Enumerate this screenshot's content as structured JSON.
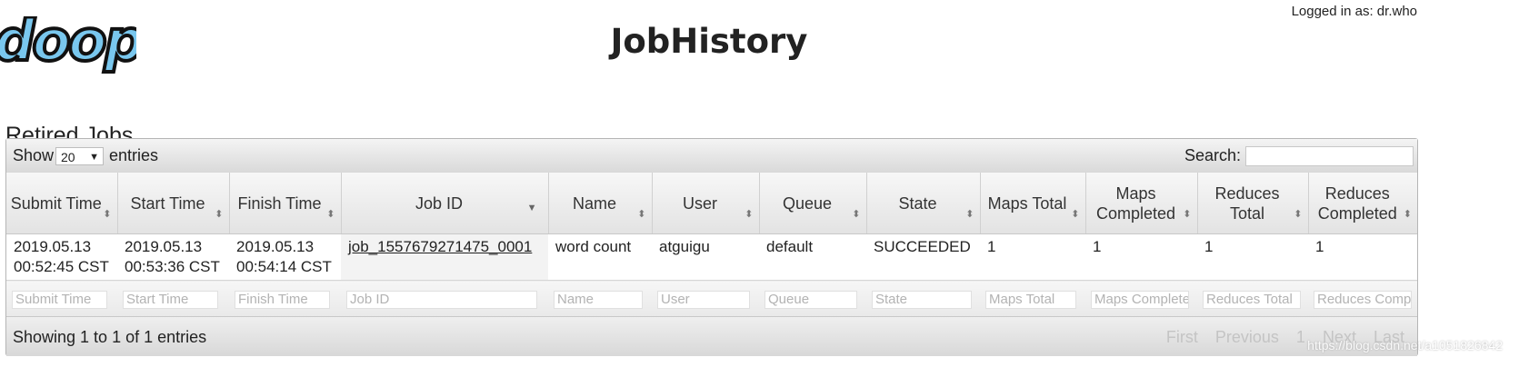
{
  "header": {
    "logo_text": "doop",
    "title": "JobHistory",
    "login_text": "Logged in as: dr.who"
  },
  "section_title": "Retired Jobs",
  "table_controls": {
    "show_label": "Show",
    "entries_value": "20",
    "entries_label": "entries",
    "search_label": "Search:",
    "search_value": ""
  },
  "columns": [
    {
      "line1": "Submit Time",
      "line2": ""
    },
    {
      "line1": "Start Time",
      "line2": ""
    },
    {
      "line1": "Finish Time",
      "line2": ""
    },
    {
      "line1": "Job ID",
      "line2": ""
    },
    {
      "line1": "Name",
      "line2": ""
    },
    {
      "line1": "User",
      "line2": ""
    },
    {
      "line1": "Queue",
      "line2": ""
    },
    {
      "line1": "State",
      "line2": ""
    },
    {
      "line1": "Maps Total",
      "line2": ""
    },
    {
      "line1": "Maps",
      "line2": "Completed"
    },
    {
      "line1": "Reduces",
      "line2": "Total"
    },
    {
      "line1": "Reduces",
      "line2": "Completed"
    }
  ],
  "rows": [
    {
      "submit_date": "2019.05.13",
      "submit_time": "00:52:45 CST",
      "start_date": "2019.05.13",
      "start_time": "00:53:36 CST",
      "finish_date": "2019.05.13",
      "finish_time": "00:54:14 CST",
      "job_id": "job_1557679271475_0001",
      "name": "word count",
      "user": "atguigu",
      "queue": "default",
      "state": "SUCCEEDED",
      "maps_total": "1",
      "maps_completed": "1",
      "reduces_total": "1",
      "reduces_completed": "1"
    }
  ],
  "filters": [
    "Submit Time",
    "Start Time",
    "Finish Time",
    "Job ID",
    "Name",
    "User",
    "Queue",
    "State",
    "Maps Total",
    "Maps Complete",
    "Reduces Total",
    "Reduces Comp"
  ],
  "footer": {
    "info": "Showing 1 to 1 of 1 entries",
    "first": "First",
    "previous": "Previous",
    "page": "1",
    "next": "Next",
    "last": "Last"
  },
  "watermark": "https://blog.csdn.net/a1051826842"
}
